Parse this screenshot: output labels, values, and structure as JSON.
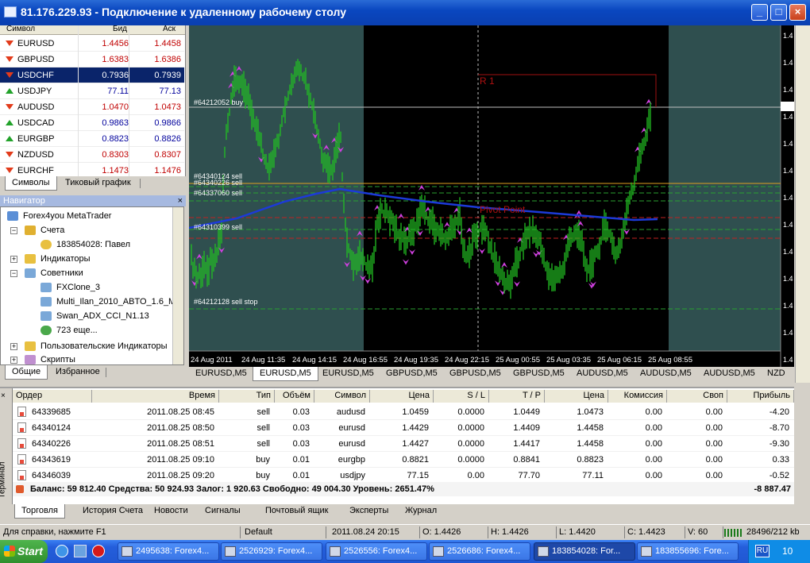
{
  "window": {
    "title": "81.176.229.93 - Подключение к удаленному рабочему столу"
  },
  "market_watch": {
    "headers": {
      "symbol": "Символ",
      "bid": "Бид",
      "ask": "Аск"
    },
    "rows": [
      {
        "symbol": "EURUSD",
        "bid": "1.4456",
        "ask": "1.4458",
        "dir": "down",
        "color": "red"
      },
      {
        "symbol": "GBPUSD",
        "bid": "1.6383",
        "ask": "1.6386",
        "dir": "down",
        "color": "red"
      },
      {
        "symbol": "USDCHF",
        "bid": "0.7936",
        "ask": "0.7939",
        "dir": "down",
        "color": "red",
        "selected": true
      },
      {
        "symbol": "USDJPY",
        "bid": "77.11",
        "ask": "77.13",
        "dir": "up",
        "color": "blue"
      },
      {
        "symbol": "AUDUSD",
        "bid": "1.0470",
        "ask": "1.0473",
        "dir": "down",
        "color": "red"
      },
      {
        "symbol": "USDCAD",
        "bid": "0.9863",
        "ask": "0.9866",
        "dir": "up",
        "color": "blue"
      },
      {
        "symbol": "EURGBP",
        "bid": "0.8823",
        "ask": "0.8826",
        "dir": "up",
        "color": "blue"
      },
      {
        "symbol": "NZDUSD",
        "bid": "0.8303",
        "ask": "0.8307",
        "dir": "down",
        "color": "red"
      },
      {
        "symbol": "EURCHF",
        "bid": "1.1473",
        "ask": "1.1476",
        "dir": "down",
        "color": "red"
      }
    ],
    "tabs": [
      "Символы",
      "Тиковый график"
    ]
  },
  "navigator": {
    "title": "Навигатор",
    "root": "Forex4you MetaTrader",
    "accounts": "Счета",
    "account": "183854028: Павел",
    "indicators": "Индикаторы",
    "advisors": "Советники",
    "advisor_items": [
      "FXClone_3",
      "Multi_Ilan_2010_ABTO_1.6_M",
      "Swan_ADX_CCI_N1.13",
      "723 еще..."
    ],
    "custom_indicators": "Пользовательские Индикаторы",
    "scripts": "Скрипты",
    "tabs": [
      "Общие",
      "Избранное"
    ]
  },
  "chart": {
    "order_labels": [
      "#64212052 buy",
      "#64340124 sell",
      "#64340226 sell",
      "#64337060 sell",
      "#64310399 sell",
      "#64212128 sell stop"
    ],
    "pivot_labels": [
      "R 1",
      "Pivot Point"
    ],
    "time_labels": [
      "24 Aug 2011",
      "24 Aug 11:35",
      "24 Aug 14:15",
      "24 Aug 16:55",
      "24 Aug 19:35",
      "24 Aug 22:15",
      "25 Aug 00:55",
      "25 Aug 03:35",
      "25 Aug 06:15",
      "25 Aug 08:55"
    ],
    "price_labels": [
      "1.4",
      "1.4",
      "1.4",
      "1.4",
      "1.4",
      "1.4",
      "1.4",
      "1.4",
      "1.4",
      "1.4",
      "1.4",
      "1.4",
      "1.4"
    ]
  },
  "chart_tabs": [
    "EURUSD,M5",
    "EURUSD,M5",
    "EURUSD,M5",
    "GBPUSD,M5",
    "GBPUSD,M5",
    "GBPUSD,M5",
    "AUDUSD,M5",
    "AUDUSD,M5",
    "AUDUSD,M5",
    "NZD"
  ],
  "terminal": {
    "side_label": "Терминал",
    "headers": [
      "Ордер",
      "Время",
      "Тип",
      "Объём",
      "Символ",
      "Цена",
      "S / L",
      "T / P",
      "Цена",
      "Комиссия",
      "Своп",
      "Прибыль"
    ],
    "rows": [
      [
        "64339685",
        "2011.08.25 08:45",
        "sell",
        "0.03",
        "audusd",
        "1.0459",
        "0.0000",
        "1.0449",
        "1.0473",
        "0.00",
        "0.00",
        "-4.20"
      ],
      [
        "64340124",
        "2011.08.25 08:50",
        "sell",
        "0.03",
        "eurusd",
        "1.4429",
        "0.0000",
        "1.4409",
        "1.4458",
        "0.00",
        "0.00",
        "-8.70"
      ],
      [
        "64340226",
        "2011.08.25 08:51",
        "sell",
        "0.03",
        "eurusd",
        "1.4427",
        "0.0000",
        "1.4417",
        "1.4458",
        "0.00",
        "0.00",
        "-9.30"
      ],
      [
        "64343619",
        "2011.08.25 09:10",
        "buy",
        "0.01",
        "eurgbp",
        "0.8821",
        "0.0000",
        "0.8841",
        "0.8823",
        "0.00",
        "0.00",
        "0.33"
      ],
      [
        "64346039",
        "2011.08.25 09:20",
        "buy",
        "0.01",
        "usdjpy",
        "77.15",
        "0.00",
        "77.70",
        "77.11",
        "0.00",
        "0.00",
        "-0.52"
      ]
    ],
    "balance_line": "Баланс: 59 812.40  Средства: 50 924.93  Залог: 1 920.63  Свободно: 49 004.30  Уровень: 2651.47%",
    "balance_profit": "-8 887.47",
    "tabs": [
      "Торговля",
      "История Счета",
      "Новости",
      "Сигналы",
      "Почтовый ящик",
      "Эксперты",
      "Журнал"
    ]
  },
  "status": {
    "help": "Для справки, нажмите F1",
    "profile": "Default",
    "datetime": "2011.08.24 20:15",
    "open": "O: 1.4426",
    "high": "H: 1.4426",
    "low": "L: 1.4420",
    "close": "C: 1.4423",
    "volume": "V: 60",
    "traffic": "28496/212 kb"
  },
  "taskbar": {
    "start": "Start",
    "tasks": [
      "2495638: Forex4...",
      "2526929: Forex4...",
      "2526556: Forex4...",
      "2526686: Forex4...",
      "183854028: For...",
      "183855696: Fore..."
    ],
    "lang": "RU",
    "clock": "10"
  },
  "colors": {
    "bg_dark": "#000000",
    "bg_session": "#2f4f4f",
    "bars": "#22c022",
    "ma": "#1c3ad8",
    "markers": "#d040e0"
  }
}
